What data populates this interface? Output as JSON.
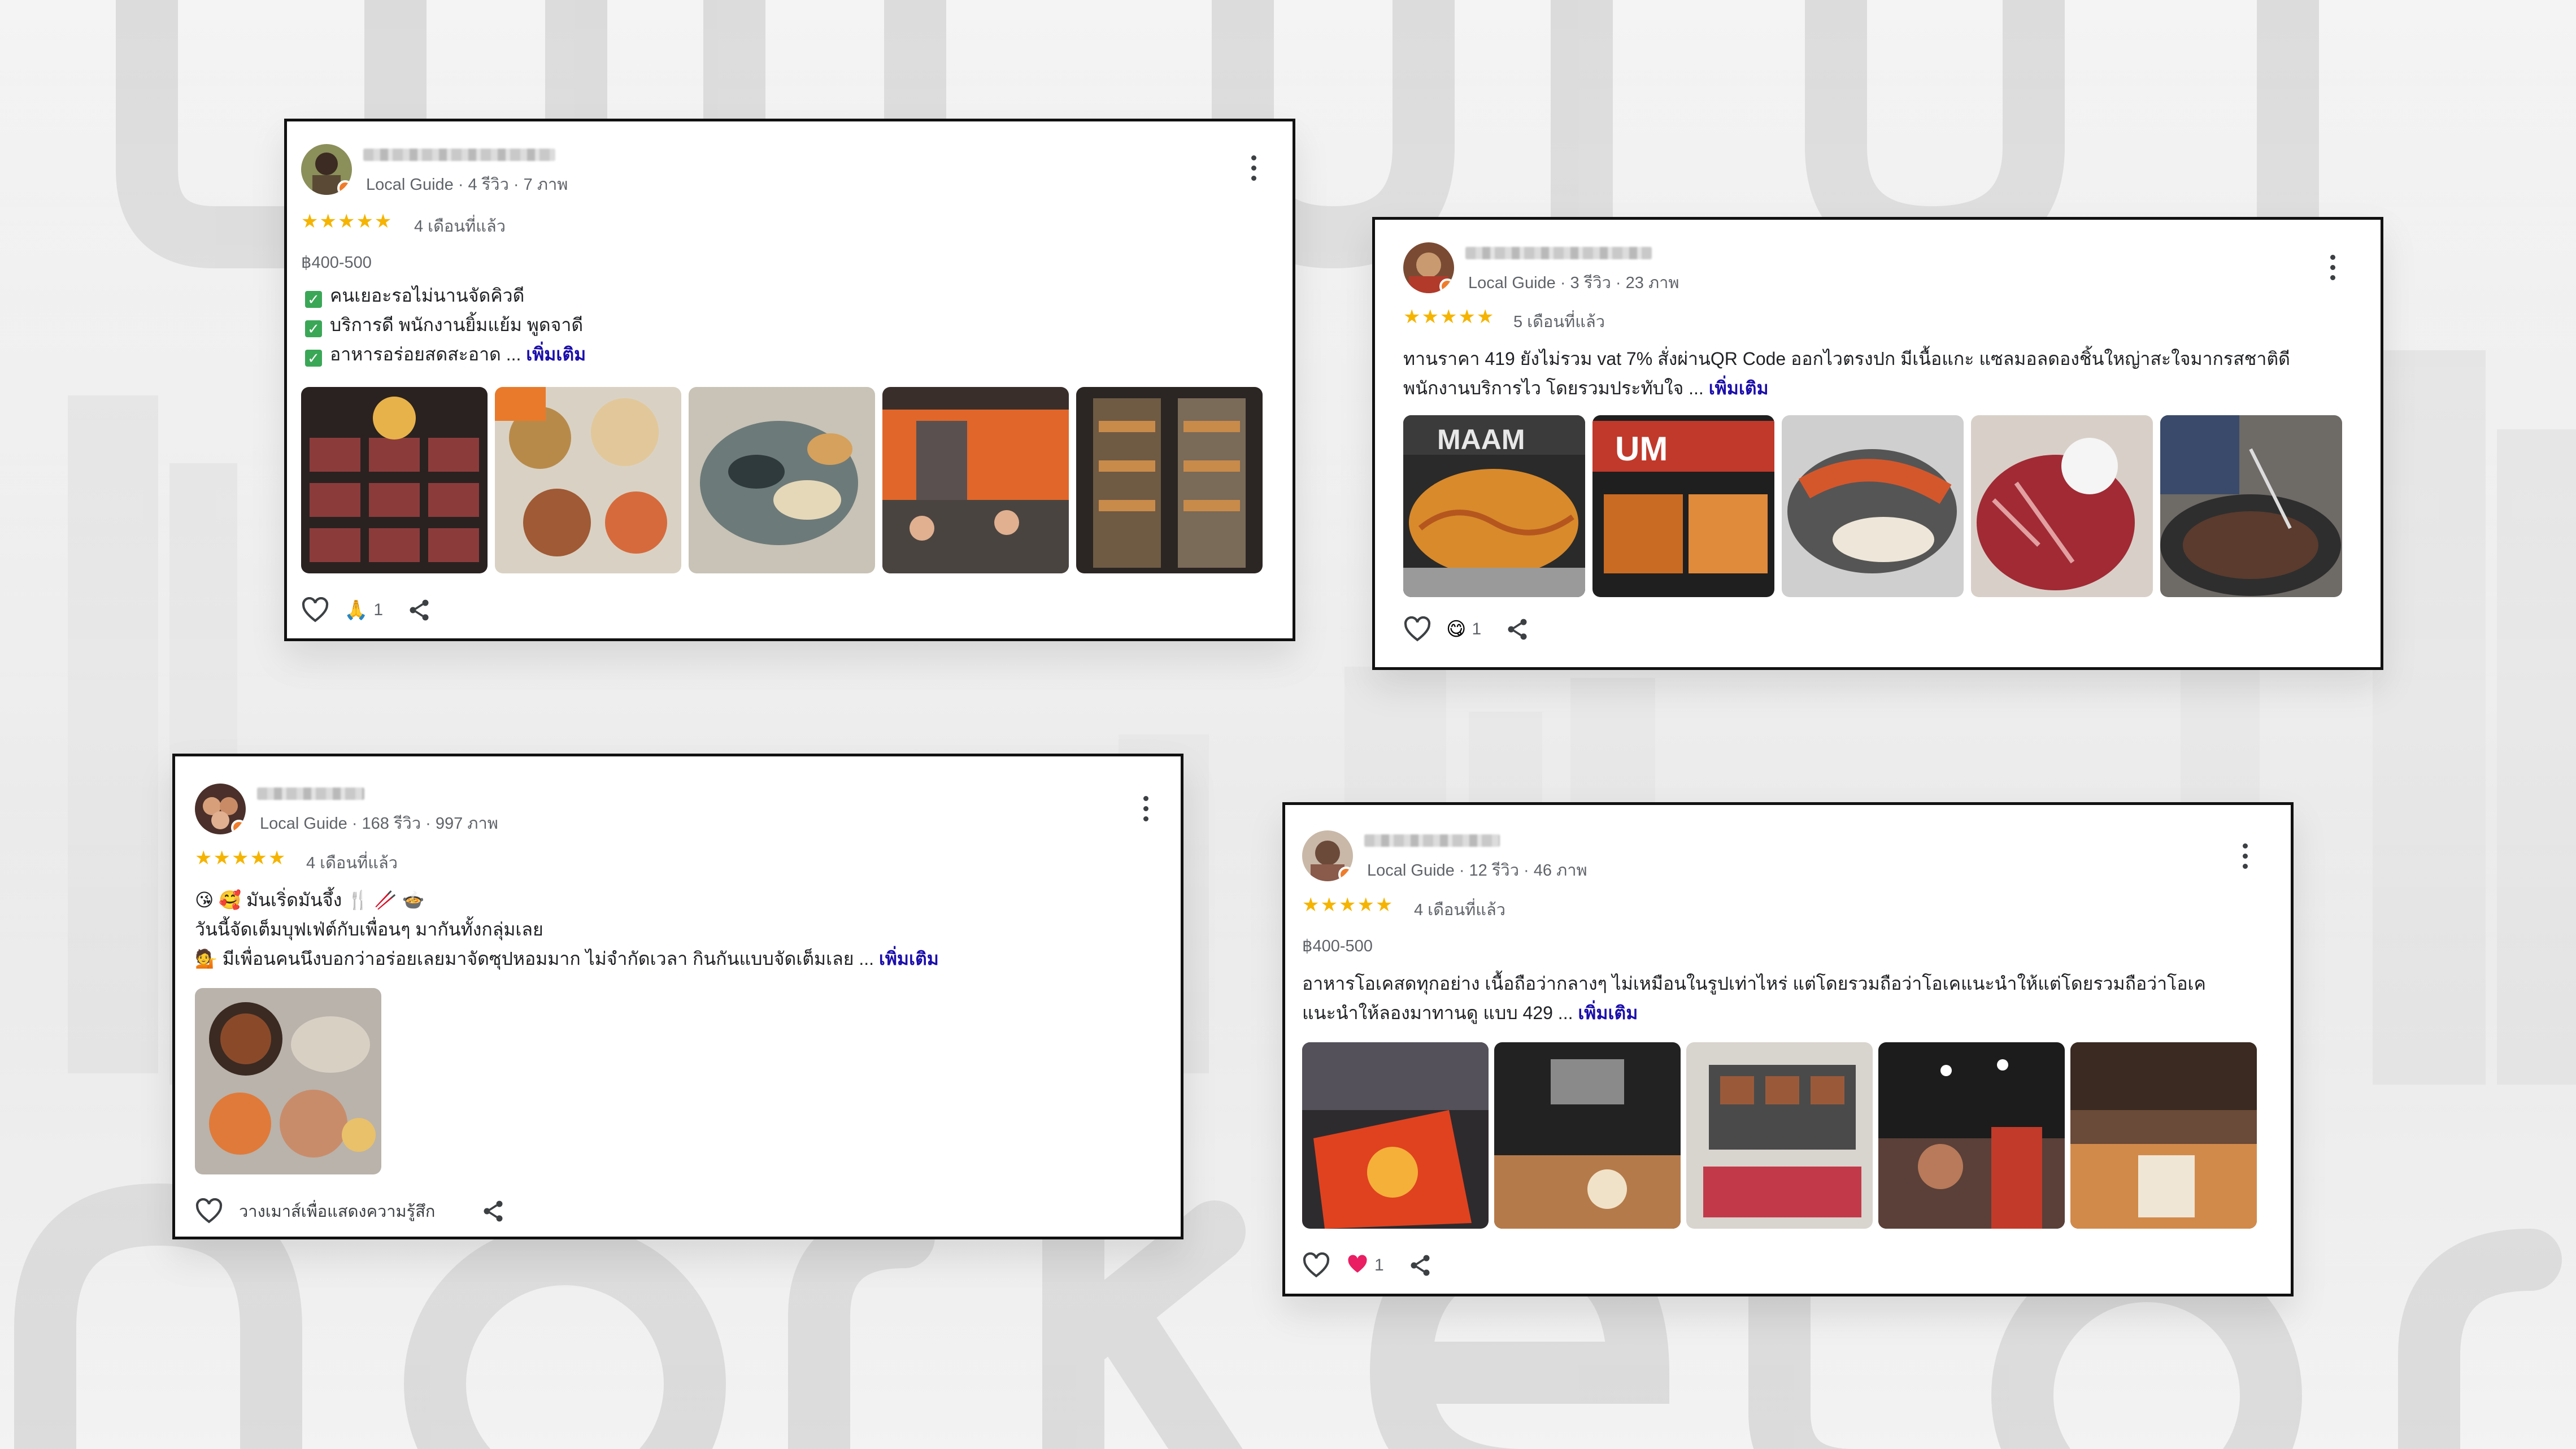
{
  "reviews": [
    {
      "meta": "Local Guide · 4 รีวิว · 7 ภาพ",
      "stars": "★★★★★",
      "time": "4 เดือนที่แล้ว",
      "price": "฿400-500",
      "checks": [
        "คนเยอะรอไม่นานจัดคิวดี",
        "บริการดี พนักงานยิ้มแย้ม พูดจาดี",
        "อาหารอร่อยสดสะอาด ..."
      ],
      "more": "เพิ่มเติม",
      "reaction_count": "1"
    },
    {
      "meta": "Local Guide · 3 รีวิว · 23 ภาพ",
      "stars": "★★★★★",
      "time": "5 เดือนที่แล้ว",
      "text1": "ทานราคา 419 ยังไม่รวม vat 7% สั่งผ่านQR Code ออกไวตรงปก มีเนื้อแกะ แซลมอลดองชิ้นใหญ่าสะใจมากรสชาติดี",
      "text2": "พนักงานบริการไว โดยรวมประทับใจ ...",
      "more": "เพิ่มเติม",
      "reaction_count": "1"
    },
    {
      "meta": "Local Guide · 168 รีวิว · 997 ภาพ",
      "stars": "★★★★★",
      "time": "4 เดือนที่แล้ว",
      "text1": "มันเริ่ดมันจึ้ง",
      "text2": "วันนี้จัดเต็มบุฟเฟ่ต์กับเพื่อนๆ มากันทั้งกลุ่มเลย",
      "text3": "มีเพื่อนคนนึงบอกว่าอร่อยเลยมาจัดซุปหอมมาก ไม่จำกัดเวลา กินกันแบบจัดเต็มเลย ...",
      "more": "เพิ่มเติม",
      "react_label": "วางเมาส์เพื่อแสดงความรู้สึก"
    },
    {
      "meta": "Local Guide · 12 รีวิว · 46 ภาพ",
      "stars": "★★★★★",
      "time": "4 เดือนที่แล้ว",
      "price": "฿400-500",
      "text1": "อาหารโอเคสดทุกอย่าง เนื้อถือว่ากลางๆ ไม่เหมือนในรูปเท่าไหร่ แต่โดยรวมถือว่าโอเคแนะนำให้แต่โดยรวมถือว่าโอเค",
      "text2": "แนะนำให้ลองมาทานดู แบบ 429 ...",
      "more": "เพิ่มเติม",
      "reaction_count": "1"
    }
  ],
  "icons": {
    "heart": "heart-icon",
    "share": "share-icon",
    "menu": "more-vert-icon"
  },
  "colors": {
    "star": "#f5b400",
    "link": "#1a0dab",
    "check": "#3aa757"
  }
}
